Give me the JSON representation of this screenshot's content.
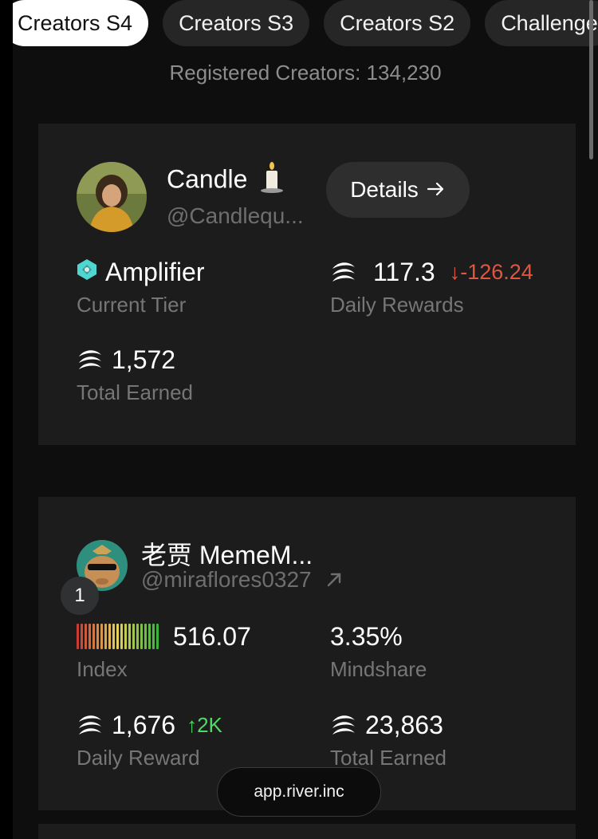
{
  "tabs": [
    {
      "label": "Creators S4",
      "active": true
    },
    {
      "label": "Creators S3",
      "active": false
    },
    {
      "label": "Creators S2",
      "active": false
    },
    {
      "label": "Challenge",
      "active": false
    }
  ],
  "registered_text": "Registered Creators: 134,230",
  "card1": {
    "name": "Candle",
    "handle": "@Candlequ...",
    "details_label": "Details",
    "tier_value": "Amplifier",
    "tier_label": "Current Tier",
    "daily_value": "117.3",
    "daily_change": "-126.24",
    "daily_label": "Daily Rewards",
    "total_value": "1,572",
    "total_label": "Total Earned"
  },
  "card2": {
    "rank": "1",
    "name": "老贾 MemeM...",
    "handle": "@miraflores0327",
    "index_value": "516.07",
    "index_label": "Index",
    "mindshare_value": "3.35%",
    "mindshare_label": "Mindshare",
    "daily_value": "1,676",
    "daily_change": "2K",
    "daily_label": "Daily Reward",
    "total_value": "23,863",
    "total_label": "Total Earned"
  },
  "url_pill": "app.river.inc",
  "colors": {
    "background": "#0e0e0f",
    "card": "#1c1c1d",
    "negative": "#e0563f",
    "positive": "#4ddc62",
    "tier_gem": "#4fd6d0"
  },
  "icons": [
    "candle-emoji-icon",
    "arrow-right-icon",
    "gem-icon",
    "river-coin-icon",
    "arrow-down-icon",
    "arrow-up-icon",
    "external-link-icon"
  ]
}
